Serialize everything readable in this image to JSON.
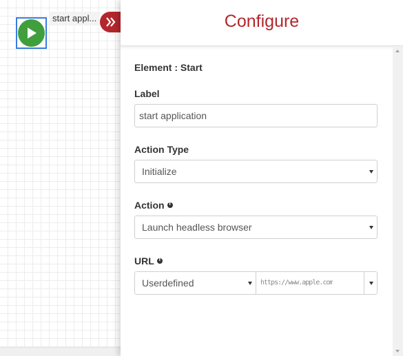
{
  "canvas": {
    "node_label": "start appl...",
    "node_color": "#3f9f3d",
    "selection_color": "#3a7be0"
  },
  "panel": {
    "title": "Configure",
    "accent_color": "#b4262c",
    "element_heading": "Element : Start",
    "label_field": {
      "label": "Label",
      "value": "start application"
    },
    "action_type": {
      "label": "Action Type",
      "selected": "Initialize"
    },
    "action": {
      "label": "Action",
      "selected": "Launch headless browser"
    },
    "url": {
      "label": "URL",
      "source_selected": "Userdefined",
      "value": "https://www.apple.com"
    }
  }
}
